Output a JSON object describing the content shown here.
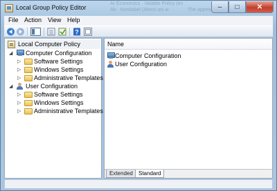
{
  "window": {
    "title": "Local Group Policy Editor",
    "ghost_text": [
      "Ar Economics · Vatable Policy (en",
      "Ab · Nostlabel (Ahest ani w",
      "The appear filter Local"
    ],
    "controls": {
      "minimize": "–",
      "maximize": "□",
      "close": "✕"
    }
  },
  "menu": {
    "file": "File",
    "action": "Action",
    "view": "View",
    "help": "Help"
  },
  "toolbar": {
    "icons": [
      "back-arrow-icon",
      "forward-arrow-icon",
      "show-hide-tree-icon",
      "export-list-icon",
      "properties-icon",
      "help-icon",
      "extended-view-icon"
    ]
  },
  "tree": {
    "root": "Local Computer Policy",
    "computer": {
      "label": "Computer Configuration",
      "children": [
        "Software Settings",
        "Windows Settings",
        "Administrative Templates"
      ]
    },
    "user": {
      "label": "User Configuration",
      "children": [
        "Software Settings",
        "Windows Settings",
        "Administrative Templates"
      ]
    }
  },
  "list": {
    "header": "Name",
    "items": [
      "Computer Configuration",
      "User Configuration"
    ]
  },
  "tabs": {
    "extended": "Extended",
    "standard": "Standard"
  }
}
